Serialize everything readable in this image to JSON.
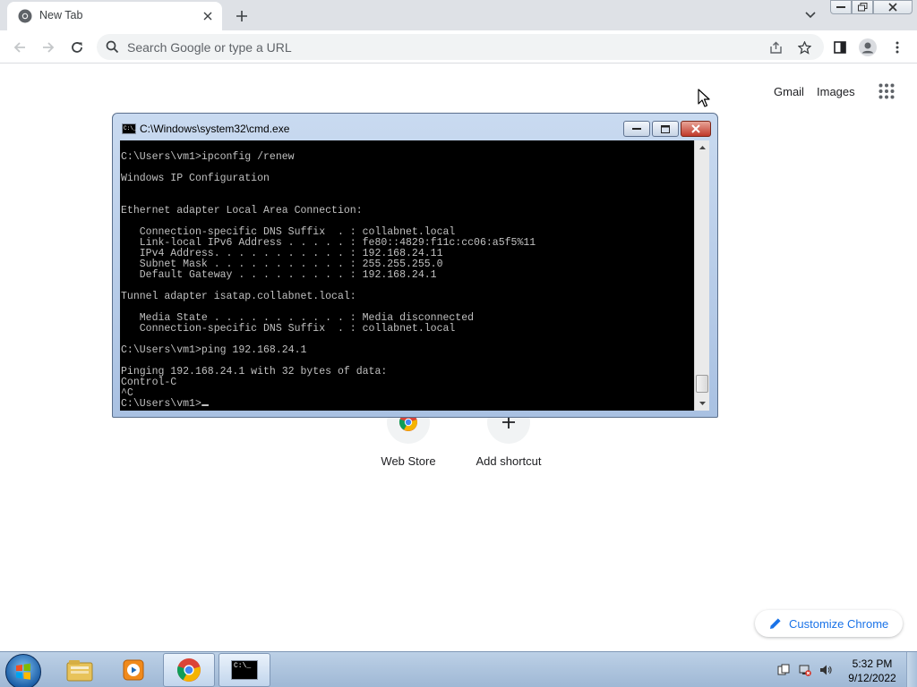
{
  "browser": {
    "tab": {
      "title": "New Tab",
      "favicon": "chrome-icon"
    },
    "omnibox": {
      "placeholder": "Search Google or type a URL"
    }
  },
  "ntp": {
    "links": {
      "gmail": "Gmail",
      "images": "Images"
    },
    "shortcuts": [
      {
        "label": "Web Store",
        "icon": "webstore-icon"
      },
      {
        "label": "Add shortcut",
        "icon": "plus-icon"
      }
    ],
    "customize_label": "Customize Chrome"
  },
  "cmd": {
    "title": "C:\\Windows\\system32\\cmd.exe",
    "lines": [
      "C:\\Users\\vm1>ipconfig /renew",
      "",
      "Windows IP Configuration",
      "",
      "",
      "Ethernet adapter Local Area Connection:",
      "",
      "   Connection-specific DNS Suffix  . : collabnet.local",
      "   Link-local IPv6 Address . . . . . : fe80::4829:f11c:cc06:a5f5%11",
      "   IPv4 Address. . . . . . . . . . . : 192.168.24.11",
      "   Subnet Mask . . . . . . . . . . . : 255.255.255.0",
      "   Default Gateway . . . . . . . . . : 192.168.24.1",
      "",
      "Tunnel adapter isatap.collabnet.local:",
      "",
      "   Media State . . . . . . . . . . . : Media disconnected",
      "   Connection-specific DNS Suffix  . : collabnet.local",
      "",
      "C:\\Users\\vm1>ping 192.168.24.1",
      "",
      "Pinging 192.168.24.1 with 32 bytes of data:",
      "Control-C",
      "^C"
    ],
    "prompt": "C:\\Users\\vm1>"
  },
  "taskbar": {
    "items": [
      "explorer-icon",
      "media-player-icon",
      "chrome-icon",
      "cmd-icon"
    ],
    "cmd_icon_text": "C:\\_",
    "clock": {
      "time": "5:32 PM",
      "date": "9/12/2022"
    }
  },
  "colors": {
    "console_bg": "#000000",
    "console_fg": "#c0c0c0",
    "chrome_accent": "#1a73e8",
    "tabstrip_bg": "#dee1e6"
  }
}
